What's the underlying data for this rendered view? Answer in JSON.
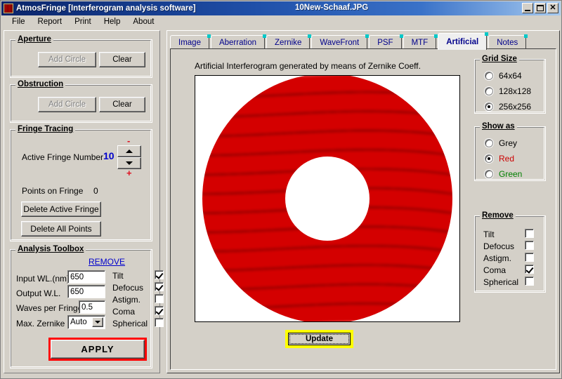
{
  "window": {
    "title": "AtmosFringe  [Interferogram analysis software]",
    "file_title": "10New-Schaaf.JPG",
    "app_icon": "fringe-pattern-icon",
    "minimize": "minimize-icon",
    "maximize": "maximize-icon",
    "close": "close-icon"
  },
  "menu": {
    "items": [
      {
        "label": "File"
      },
      {
        "label": "Report"
      },
      {
        "label": "Print"
      },
      {
        "label": "Help"
      },
      {
        "label": "About"
      }
    ]
  },
  "aperture": {
    "title": "Aperture",
    "add_circle": "Add Circle",
    "add_circle_disabled": true,
    "clear": "Clear"
  },
  "obstruction": {
    "title": "Obstruction",
    "add_circle": "Add Circle",
    "add_circle_disabled": true,
    "clear": "Clear"
  },
  "fringe_tracing": {
    "title": "Fringe Tracing",
    "active_fringe_label": "Active Fringe Number",
    "active_fringe_value": "10",
    "spin_minus": "-",
    "spin_plus": "+",
    "points_label": "Points on  Fringe",
    "points_value": "0",
    "delete_active": "Delete Active Fringe",
    "delete_all": "Delete  All  Points"
  },
  "analysis_toolbox": {
    "title": "Analysis Toolbox",
    "remove_link": "REMOVE",
    "fields": [
      {
        "label": "Input WL.(nm)",
        "value": "650"
      },
      {
        "label": "Output W.L.",
        "value": "650"
      },
      {
        "label": "Waves per Fringe",
        "value": "0.5"
      }
    ],
    "max_zernike_label": "Max. Zernike",
    "max_zernike_value": "Auto",
    "max_zernike_options": [
      "Auto"
    ],
    "remove_items": [
      {
        "label": "Tilt",
        "checked": true
      },
      {
        "label": "Defocus",
        "checked": true
      },
      {
        "label": "Astigm.",
        "checked": false
      },
      {
        "label": "Coma",
        "checked": true
      },
      {
        "label": "Spherical",
        "checked": false
      }
    ],
    "apply": "APPLY",
    "apply_highlight_color": "#ff0000"
  },
  "tabs": [
    {
      "label": "Image",
      "active": false
    },
    {
      "label": "Aberration",
      "active": false
    },
    {
      "label": "Zernike",
      "active": false
    },
    {
      "label": "WaveFront",
      "active": false
    },
    {
      "label": "PSF",
      "active": false
    },
    {
      "label": "MTF",
      "active": false
    },
    {
      "label": "Artificial",
      "active": true
    },
    {
      "label": "Notes",
      "active": false
    }
  ],
  "artificial_tab": {
    "caption": "Artificial  Interferogram generated by means of Zernike Coeff.",
    "update_button": "Update",
    "update_focus_color": "#ffff00",
    "interferogram": {
      "name": "artificial-interferogram",
      "fringe_color": "#d40000",
      "background": "#ffffff",
      "dark_color": "#000000",
      "obstruction_color": "#ffffff",
      "fringe_count": 13,
      "orientation": "horizontal"
    },
    "grid_size": {
      "title": "Grid Size",
      "options": [
        {
          "label": "64x64",
          "selected": false
        },
        {
          "label": "128x128",
          "selected": false
        },
        {
          "label": "256x256",
          "selected": true
        }
      ]
    },
    "show_as": {
      "title": "Show as",
      "options": [
        {
          "label": "Grey",
          "selected": false,
          "color": "#000000"
        },
        {
          "label": "Red",
          "selected": true,
          "color": "#cc0000"
        },
        {
          "label": "Green",
          "selected": false,
          "color": "#008000"
        }
      ]
    },
    "remove": {
      "title": "Remove",
      "items": [
        {
          "label": "Tilt",
          "checked": false
        },
        {
          "label": "Defocus",
          "checked": false
        },
        {
          "label": "Astigm.",
          "checked": false
        },
        {
          "label": "Coma",
          "checked": true
        },
        {
          "label": "Spherical",
          "checked": false
        }
      ]
    }
  }
}
